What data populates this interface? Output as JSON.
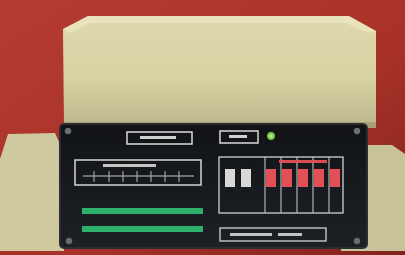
{
  "photo": {
    "subject": "",
    "colors": {
      "background_red": "#a83228",
      "background_dark_red": "#7c1f18",
      "case_cream": "#d8d3a6",
      "case_shadow": "#b7b185",
      "panel_black": "#17191c",
      "panel_edge": "#2a2e33",
      "label_white": "#e8e8e8",
      "led_green": "#92e05c",
      "indicator_red": "#e34f56",
      "stripe_green": "#2db06a"
    },
    "icons": [
      "screw-icon",
      "led-icon",
      "switch-icon"
    ]
  }
}
